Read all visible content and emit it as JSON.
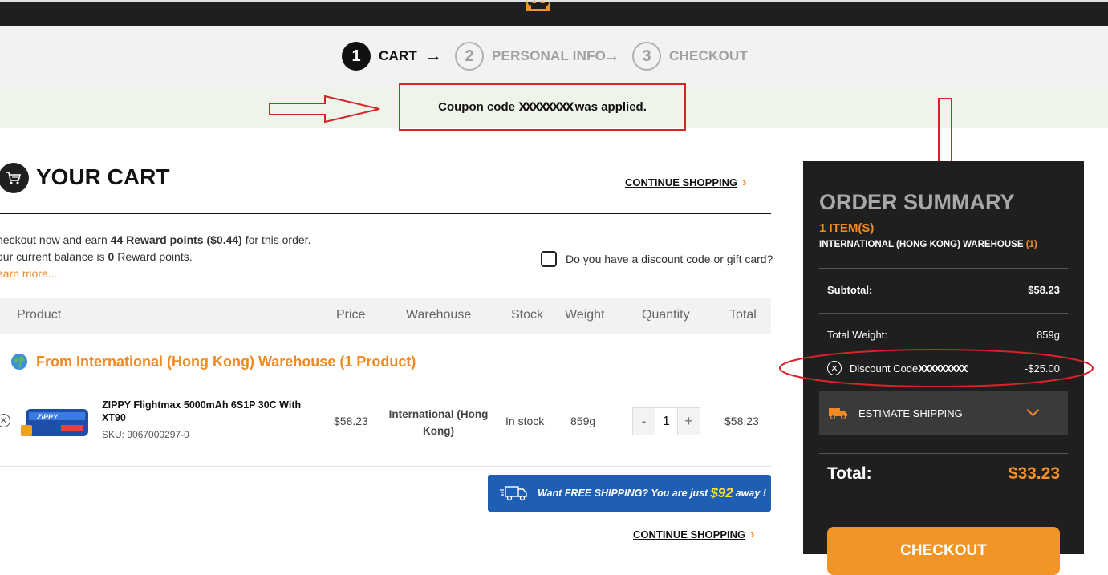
{
  "steps": [
    {
      "num": "1",
      "label": "CART"
    },
    {
      "num": "2",
      "label": "PERSONAL INFO"
    },
    {
      "num": "3",
      "label": "CHECKOUT"
    }
  ],
  "step_arrow": "→",
  "notice": {
    "prefix": "Coupon code",
    "code_redacted": "XXXXXXXX",
    "suffix": "was applied."
  },
  "cart": {
    "title": "YOUR CART",
    "continue_label": "CONTINUE SHOPPING",
    "reward_line1_a": "heckout now and earn",
    "reward_points": "44 Reward points",
    "reward_value": "($0.44)",
    "reward_line1_b": "for this order.",
    "reward_line2_a": "our current balance is",
    "reward_balance": "0",
    "reward_line2_b": "Reward points.",
    "learn_more": "earn more...",
    "discount_question": "Do you have a discount code or gift card?",
    "columns": {
      "product": "Product",
      "price": "Price",
      "warehouse": "Warehouse",
      "stock": "Stock",
      "weight": "Weight",
      "quantity": "Quantity",
      "total": "Total"
    },
    "warehouse_group": "From International (Hong Kong) Warehouse (1 Product)",
    "item": {
      "name": "ZIPPY Flightmax 5000mAh 6S1P 30C With XT90",
      "sku": "SKU: 9067000297-0",
      "price": "$58.23",
      "warehouse": "International (Hong Kong)",
      "stock": "In stock",
      "weight": "859g",
      "quantity": "1",
      "total": "$58.23"
    },
    "free_shipping": {
      "prefix": "Want FREE SHIPPING? You are just",
      "amount": "$92",
      "suffix": "away !"
    }
  },
  "summary": {
    "title": "ORDER SUMMARY",
    "items": "1 ITEM(S)",
    "warehouse": "INTERNATIONAL (HONG KONG) WAREHOUSE",
    "warehouse_count": "(1)",
    "subtotal_label": "Subtotal:",
    "subtotal_value": "$58.23",
    "weight_label": "Total Weight:",
    "weight_value": "859g",
    "discount_label": "Discount Code",
    "discount_code_redacted": "XXXXXXXXX",
    "discount_colon": ":",
    "discount_value": "-$25.00",
    "estimate_label": "ESTIMATE SHIPPING",
    "total_label": "Total:",
    "total_value": "$33.23",
    "checkout_label": "CHECKOUT"
  },
  "colors": {
    "accent": "#f08a24",
    "dark": "#1f1f1f",
    "annotation": "#d8232a",
    "free_ship_bg": "#1e5fb4"
  }
}
